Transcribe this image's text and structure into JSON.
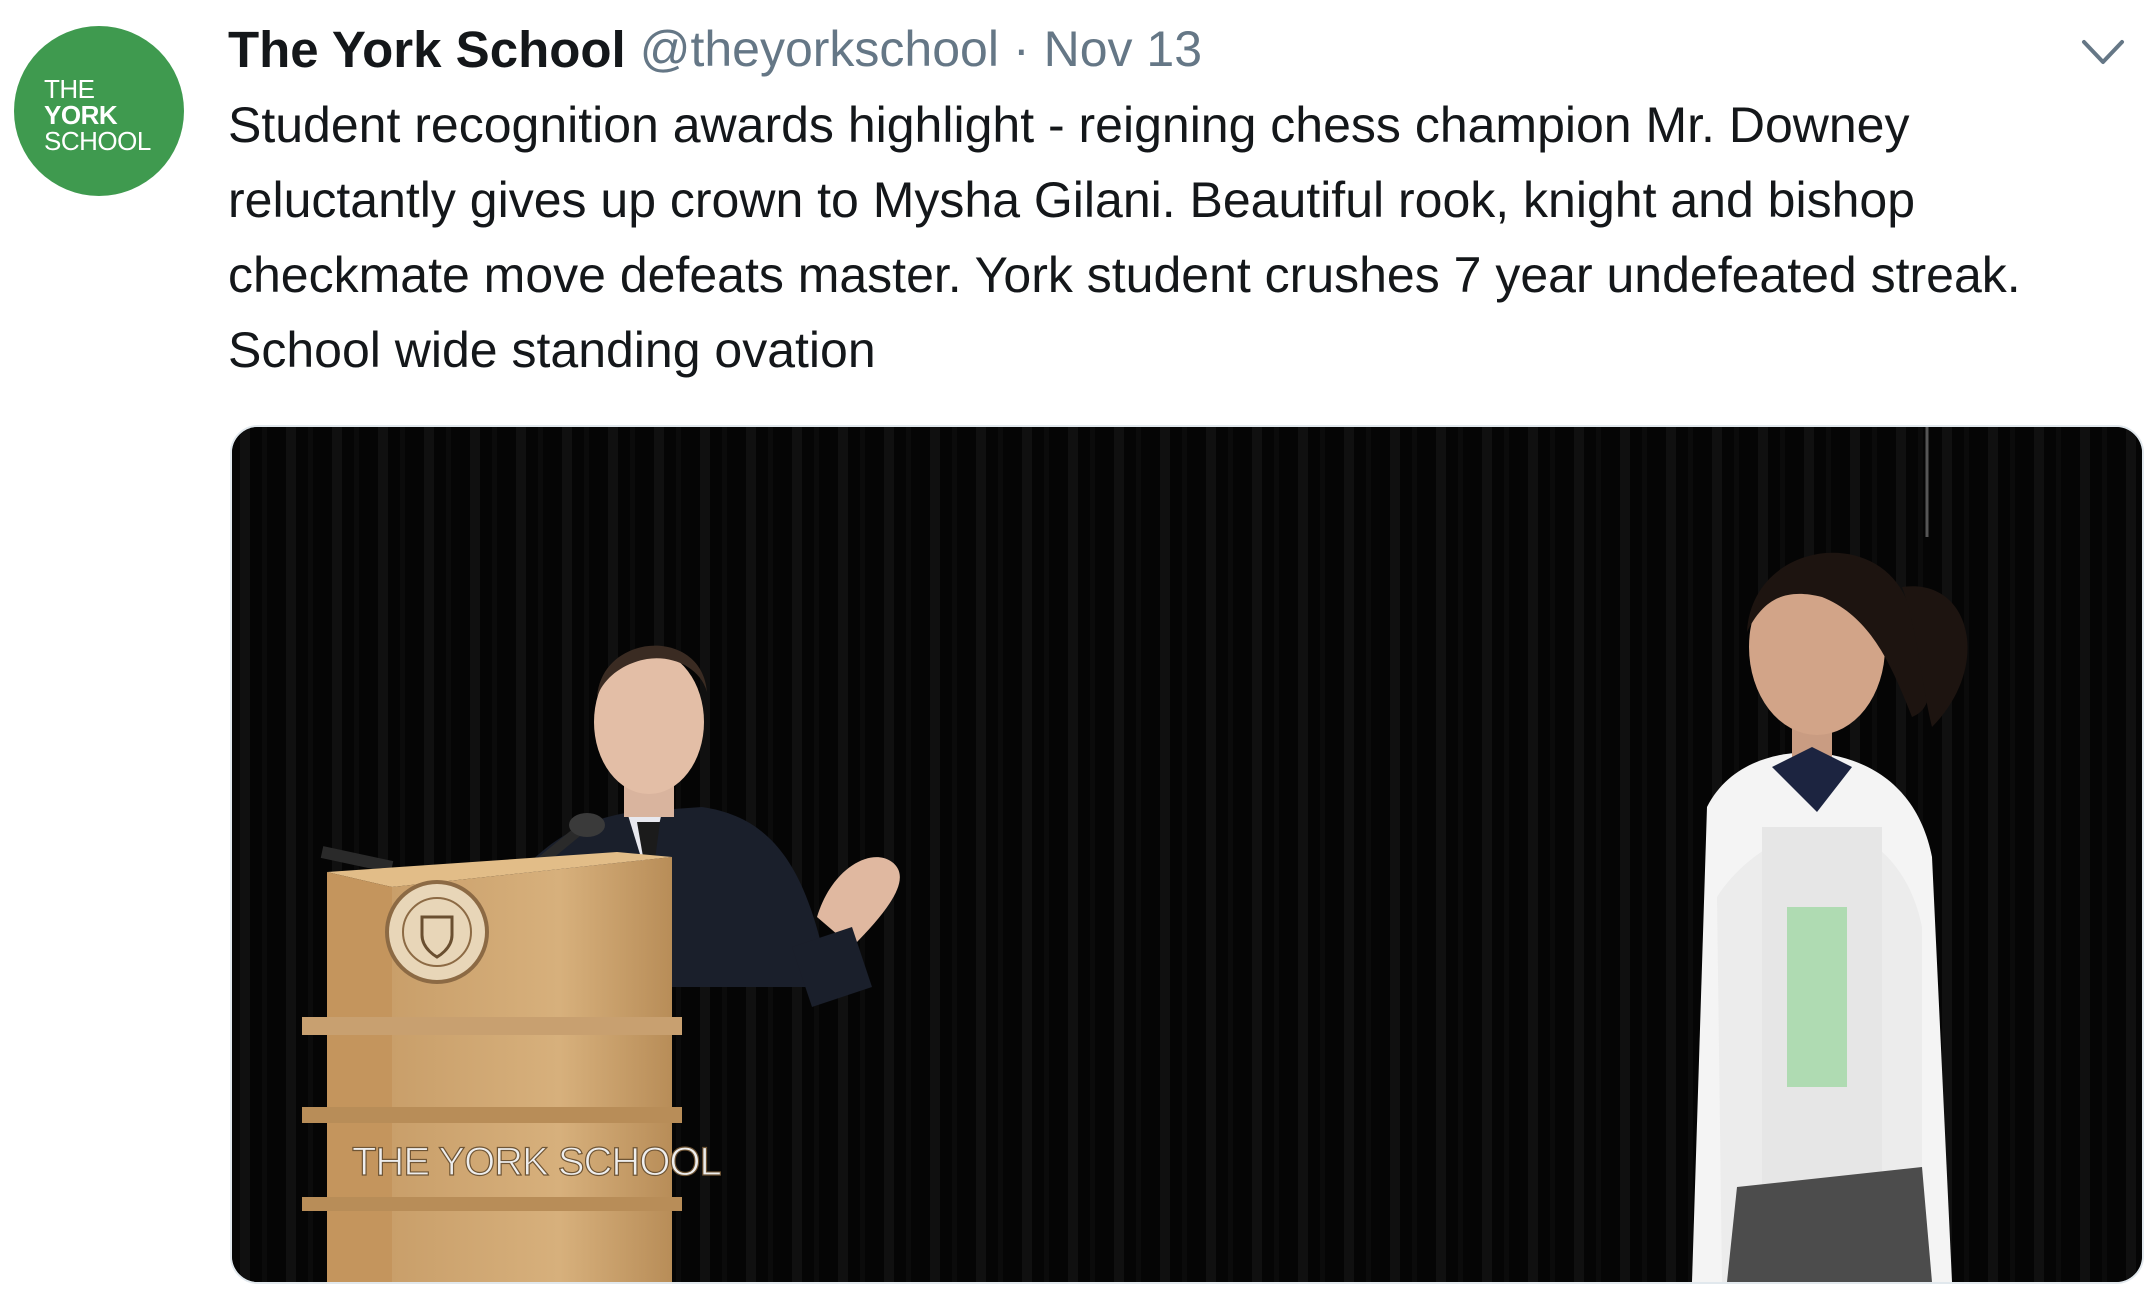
{
  "account": {
    "avatar_lines": [
      "THE",
      "YORK",
      "SCHOOL"
    ],
    "display_name": "The York School",
    "handle": "@theyorkschool",
    "separator": "·",
    "date": "Nov 13"
  },
  "tweet": {
    "text_lines": [
      "Student recognition awards highlight - reigning chess champion Mr. Downey",
      "reluctantly gives up crown to Mysha Gilani. Beautiful rook, knight and bishop",
      "checkmate move defeats master. York student crushes 7 year undefeated streak.",
      "School wide standing ovation"
    ]
  },
  "media": {
    "podium_sign": "THE YORK SCHOOL"
  },
  "icons": {
    "menu": "chevron-down-icon"
  },
  "colors": {
    "brand_green": "#3f9a4f",
    "name": "#14171a",
    "secondary": "#657786"
  }
}
